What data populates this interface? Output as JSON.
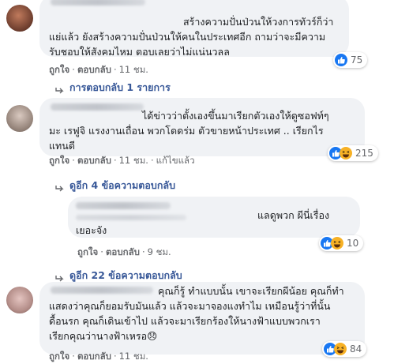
{
  "comments": [
    {
      "lines": [
        "สร้างความปั่นป่วนให้วงการทัวร์ก็ว่า",
        "แย่แล้ว ยังสร้างความปั่นป่วนให้คนในประเทศอีก ถามว่าจะมีความ",
        "รับชอบให้สังคมไหม ตอบเลยว่าไม่แน่นวลล"
      ],
      "like": "ถูกใจ",
      "reply": "ตอบกลับ",
      "time": "11 ชม.",
      "reaction_count": "75"
    },
    {
      "lines": [
        "ได้ข่าวว่าตั้งเองขึ้นมาเรียกตัวเองให้ดูซอฟท์ๆ",
        "มะ เรฟูจิ แรงงานเถื่อน พวกโดดร่ม ตัวขายหน้าประเทศ .. เรียกไร",
        "แทนดี"
      ],
      "like": "ถูกใจ",
      "reply": "ตอบกลับ",
      "time": "11 ชม.",
      "edited": "แก้ไขแล้ว",
      "reaction_count": "215"
    },
    {
      "lines": [
        "แลดูพวก   ผีนี่เรื่อง",
        "เยอะจัง"
      ],
      "like": "ถูกใจ",
      "reply": "ตอบกลับ",
      "time": "9 ชม.",
      "reaction_count": "10"
    },
    {
      "lines": [
        "คุณก็รู้ ทำแบบนั้น เขาจะเรียกผีน้อย คุณก็ทำ",
        "แสดงว่าคุณก็ยอมรับมันแล้ว แล้วจะมาจองแงทำไม เหมือนรู้ว่าที่นั้น",
        "ดื้อนรก คุณก็เดินเข้าไป แล้วจะมาเรียกร้องให้นางฟ้าแบบพวกเรา",
        "เรียกคุณว่านางฟ้าเหรอ😞"
      ],
      "like": "ถูกใจ",
      "reply": "ตอบกลับ",
      "time": "11 ชม.",
      "reaction_count": "84"
    }
  ],
  "reply_links": [
    "การตอบกลับ 1 รายการ",
    "ดูอีก 4 ข้อความตอบกลับ",
    "ดูอีก 22 ข้อความตอบกลับ"
  ],
  "colors": {
    "link": "#385898",
    "bubble": "#f0f2f5",
    "like": "#1877f2",
    "haha": "#f7b125"
  },
  "icons": [
    "reply-arrow-icon",
    "like-reaction-icon",
    "haha-reaction-icon"
  ]
}
